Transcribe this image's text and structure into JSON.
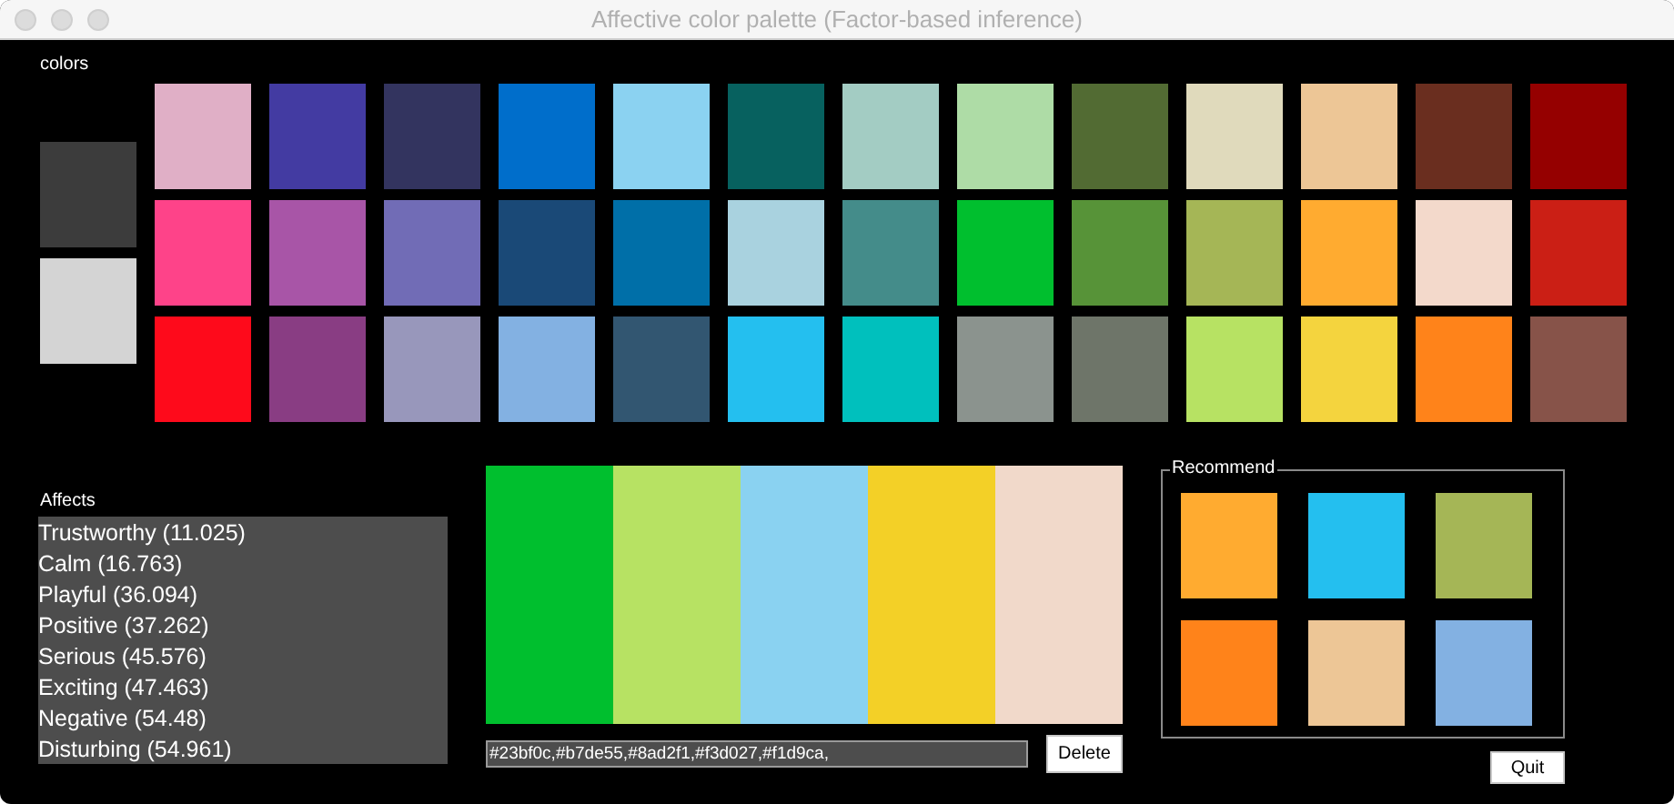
{
  "window": {
    "title": "Affective color palette (Factor-based inference)"
  },
  "colors": {
    "label": "colors",
    "previews": [
      {
        "color": "#3c3c3c"
      },
      {
        "color": "#d4d4d4"
      }
    ],
    "rows": [
      [
        {
          "color": "#e0afc6"
        },
        {
          "color": "#433ba2"
        },
        {
          "color": "#33345f"
        },
        {
          "color": "#006ecb"
        },
        {
          "color": "#8bd2f1"
        },
        {
          "color": "#07615f"
        },
        {
          "color": "#a3ccc3"
        },
        {
          "color": "#aedca6"
        },
        {
          "color": "#526b33"
        },
        {
          "color": "#e0dabc"
        },
        {
          "color": "#edc696"
        },
        {
          "color": "#6a2e1f"
        },
        {
          "color": "#950000"
        }
      ],
      [
        {
          "color": "#fe4389"
        },
        {
          "color": "#a855a7"
        },
        {
          "color": "#716cb6"
        },
        {
          "color": "#1a4977"
        },
        {
          "color": "#006fa8"
        },
        {
          "color": "#a9d2df"
        },
        {
          "color": "#448c8a"
        },
        {
          "color": "#00bf2e"
        },
        {
          "color": "#579338"
        },
        {
          "color": "#a5b656"
        },
        {
          "color": "#ffab30"
        },
        {
          "color": "#f3d9cb"
        },
        {
          "color": "#cb1f15"
        }
      ],
      [
        {
          "color": "#fe0a1b"
        },
        {
          "color": "#893d83"
        },
        {
          "color": "#9897bb"
        },
        {
          "color": "#83b1e2"
        },
        {
          "color": "#325671"
        },
        {
          "color": "#24bfef"
        },
        {
          "color": "#00c0bd"
        },
        {
          "color": "#8b938e"
        },
        {
          "color": "#6e7569"
        },
        {
          "color": "#b7e263"
        },
        {
          "color": "#f4d43e"
        },
        {
          "color": "#ff831a"
        },
        {
          "color": "#875349"
        }
      ]
    ]
  },
  "affects": {
    "label": "Affects",
    "items": [
      "Trustworthy (11.025)",
      "Calm (16.763)",
      "Playful (36.094)",
      "Positive (37.262)",
      "Serious (45.576)",
      "Exciting (47.463)",
      "Negative (54.48)",
      "Disturbing (54.961)"
    ]
  },
  "palette": {
    "bars": [
      {
        "color": "#00bf2e"
      },
      {
        "color": "#b7e263"
      },
      {
        "color": "#8ad2f1"
      },
      {
        "color": "#f3d027"
      },
      {
        "color": "#f1d9ca"
      }
    ],
    "code": "#23bf0c,#b7de55,#8ad2f1,#f3d027,#f1d9ca,",
    "delete_button": "Delete"
  },
  "recommend": {
    "label": "Recommend",
    "swatches": [
      {
        "color": "#ffab30"
      },
      {
        "color": "#24bfef"
      },
      {
        "color": "#a5b656"
      },
      {
        "color": "#ff831a"
      },
      {
        "color": "#edc696"
      },
      {
        "color": "#83b1e2"
      }
    ]
  },
  "quit_button": "Quit"
}
